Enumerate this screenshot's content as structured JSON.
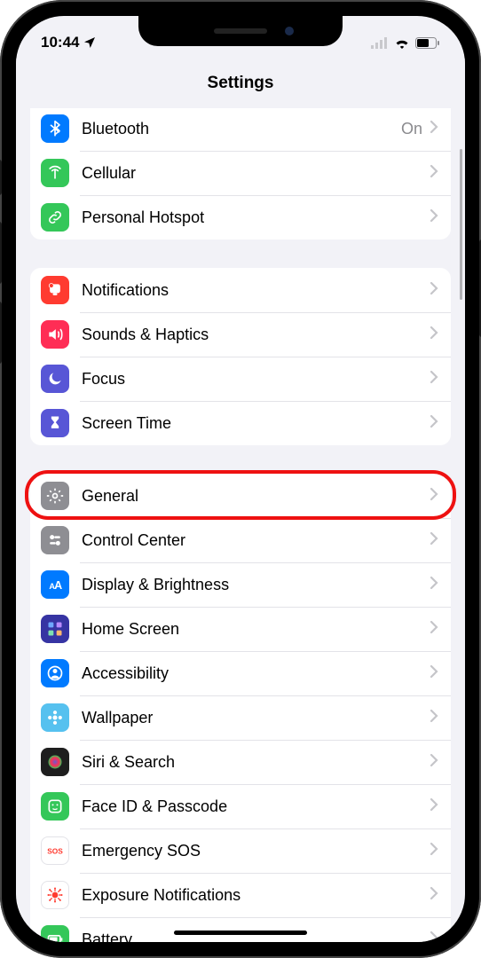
{
  "status": {
    "time": "10:44"
  },
  "header": {
    "title": "Settings"
  },
  "groups": [
    {
      "id": "connectivity",
      "rows": [
        {
          "id": "bluetooth",
          "label": "Bluetooth",
          "value": "On",
          "icon": "bluetooth",
          "color": "#007aff"
        },
        {
          "id": "cellular",
          "label": "Cellular",
          "icon": "antenna",
          "color": "#34c759"
        },
        {
          "id": "hotspot",
          "label": "Personal Hotspot",
          "icon": "link",
          "color": "#34c759"
        }
      ]
    },
    {
      "id": "alerts",
      "rows": [
        {
          "id": "notifications",
          "label": "Notifications",
          "icon": "bell",
          "color": "#ff3b30"
        },
        {
          "id": "sounds",
          "label": "Sounds & Haptics",
          "icon": "speaker",
          "color": "#ff2d55"
        },
        {
          "id": "focus",
          "label": "Focus",
          "icon": "moon",
          "color": "#5856d6"
        },
        {
          "id": "screentime",
          "label": "Screen Time",
          "icon": "hourglass",
          "color": "#5856d6"
        }
      ]
    },
    {
      "id": "general-group",
      "rows": [
        {
          "id": "general",
          "label": "General",
          "icon": "gear",
          "color": "#8e8e93",
          "highlight": true
        },
        {
          "id": "controlcenter",
          "label": "Control Center",
          "icon": "switches",
          "color": "#8e8e93"
        },
        {
          "id": "display",
          "label": "Display & Brightness",
          "icon": "textsize",
          "color": "#007aff"
        },
        {
          "id": "homescreen",
          "label": "Home Screen",
          "icon": "grid",
          "color": "#3634a3"
        },
        {
          "id": "accessibility",
          "label": "Accessibility",
          "icon": "person",
          "color": "#007aff"
        },
        {
          "id": "wallpaper",
          "label": "Wallpaper",
          "icon": "flower",
          "color": "#56c1ef"
        },
        {
          "id": "siri",
          "label": "Siri & Search",
          "icon": "siri",
          "color": "#1e1e1e"
        },
        {
          "id": "faceid",
          "label": "Face ID & Passcode",
          "icon": "face",
          "color": "#34c759"
        },
        {
          "id": "sos",
          "label": "Emergency SOS",
          "icon": "sos",
          "color": "#ffffff",
          "fg": "#ff3b30"
        },
        {
          "id": "exposure",
          "label": "Exposure Notifications",
          "icon": "virus",
          "color": "#ffffff",
          "fg": "#ff3b30"
        },
        {
          "id": "battery",
          "label": "Battery",
          "icon": "battery",
          "color": "#34c759"
        }
      ]
    }
  ]
}
